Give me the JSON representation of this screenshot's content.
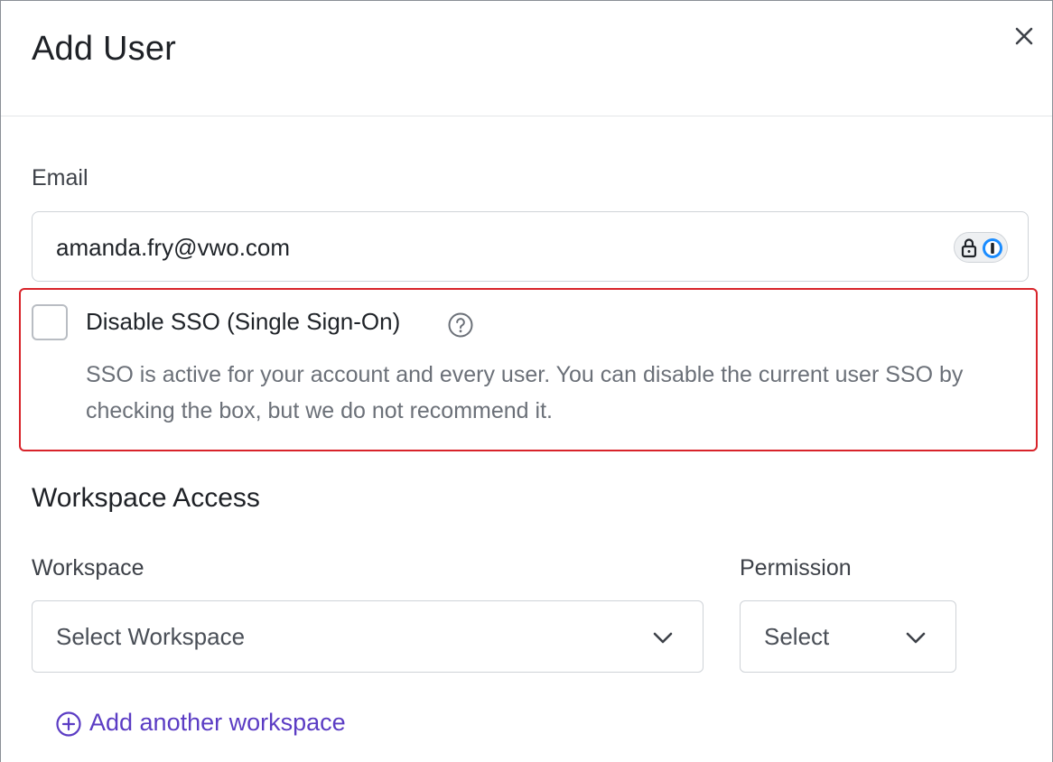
{
  "modal": {
    "title": "Add User",
    "close_icon": "close-icon"
  },
  "email": {
    "label": "Email",
    "value": "amanda.fry@vwo.com",
    "password_manager_icon": "password-manager-icon"
  },
  "sso": {
    "checkbox_checked": false,
    "label": "Disable SSO (Single Sign-On)",
    "help_icon": "question-circle-icon",
    "description": "SSO is active for your account and every user. You can disable the current user SSO by checking the box, but we do not recommend it.",
    "highlight_color": "#d8232a"
  },
  "workspace_access": {
    "title": "Workspace Access",
    "workspace_label": "Workspace",
    "workspace_select": "Select Workspace",
    "permission_label": "Permission",
    "permission_select": "Select",
    "add_link": "Add another workspace",
    "add_icon": "plus-circle-icon",
    "link_color": "#5b3cc4"
  }
}
